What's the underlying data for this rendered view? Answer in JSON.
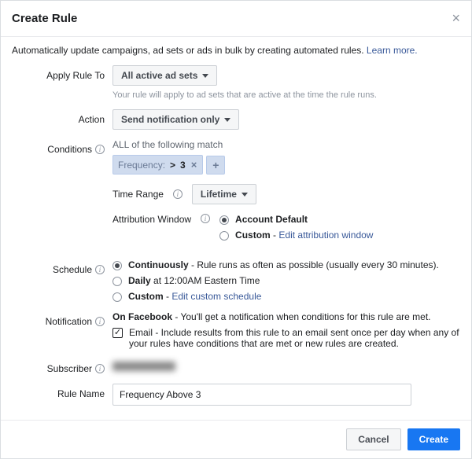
{
  "header": {
    "title": "Create Rule"
  },
  "intro": {
    "text": "Automatically update campaigns, ad sets or ads in bulk by creating automated rules. ",
    "learn_more": "Learn more."
  },
  "apply_to": {
    "label": "Apply Rule To",
    "value": "All active ad sets",
    "hint": "Your rule will apply to ad sets that are active at the time the rule runs."
  },
  "action": {
    "label": "Action",
    "value": "Send notification only"
  },
  "conditions": {
    "label": "Conditions",
    "header": "ALL of the following match",
    "chip_label": "Frequency:",
    "chip_op": ">",
    "chip_val": "3",
    "time_range_label": "Time Range",
    "time_range_value": "Lifetime",
    "attr_window_label": "Attribution Window",
    "attr_opts": {
      "default": "Account Default",
      "custom": "Custom",
      "custom_link": "Edit attribution window"
    }
  },
  "schedule": {
    "label": "Schedule",
    "continuously_label": "Continuously",
    "continuously_after": " - Rule runs as often as possible (usually every 30 minutes).",
    "daily_label": "Daily",
    "daily_after": " at 12:00AM Eastern Time",
    "custom_label": "Custom",
    "custom_link": "Edit custom schedule"
  },
  "notification": {
    "label": "Notification",
    "fb_label": "On Facebook",
    "fb_after": " - You'll get a notification when conditions for this rule are met.",
    "email_label": "Email",
    "email_after": " - Include results from this rule to an email sent once per day when any of your rules have conditions that are met or new rules are created."
  },
  "subscriber": {
    "label": "Subscriber"
  },
  "rule_name": {
    "label": "Rule Name",
    "value": "Frequency Above 3"
  },
  "footer": {
    "cancel": "Cancel",
    "create": "Create"
  }
}
